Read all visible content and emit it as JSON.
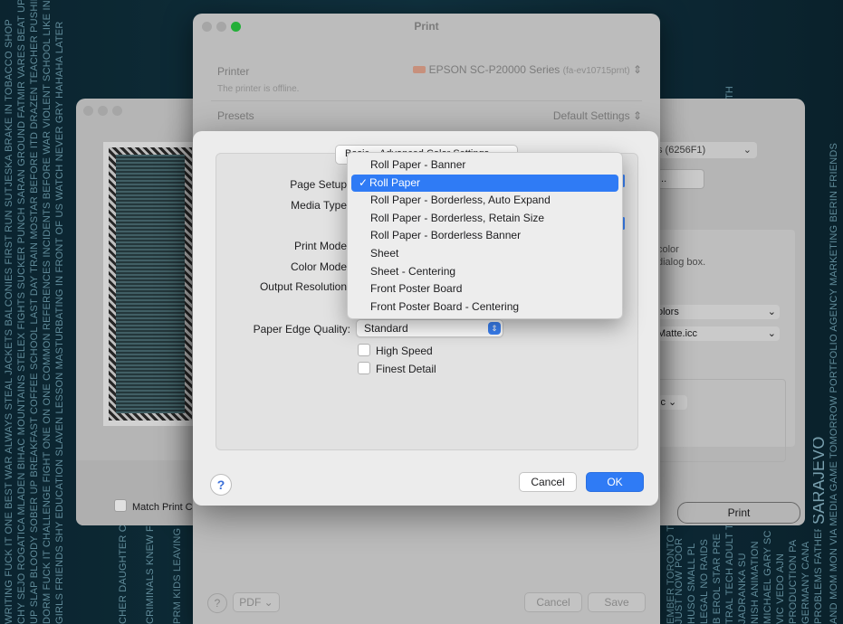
{
  "wallpaper": {
    "columns": [
      "WRITING FUCK IT ONE BEST WAR ALWAYS STEAL JACKETS BALCONIES FIRST RUN SUTJESKA BRAKE IN TOBACCO SHOP",
      "CHY SEJO ROGATICA MLADEN BIHAC MOUNTAINS STELEX FIGHTS SUCKER PUNCH SARAN GROUND FATMIR VARES BEAT UP",
      "UP SLAP BLOODY SOBER UP BREAKFAST COFFEE SCHOOL LAST DAY TRAIN MOSTAR BEFORE ITD DRAZEN TEACHER PUSHING",
      "DORM FUCK IT CHALLENGE FIGHT ONE ON ONE COMMON REFERENCES INCIDENTS BEFORE WAR VIOLENT SCHOOL LIKE INT",
      "GIRLS FRIENDS SHY EDUCATION SLAVEN LESSON MASTURBATING IN FRONT OF US WATCH NEVER GRY HAHAHA LATER",
      "CHER DAUGHTER CRIMINALS TRAP HALA I KNEW PAST BEST FRIEND PARING WAR ADVENTURE",
      "CRIMINALS KNEW FRIENDS GA BEST PARING WAR KIDS LEAVING DOES COUSIN KILL",
      "PRM KIDS LEAVING COUSIN KILL NIS APARTMENT",
      "EMBER TORONTO TORONTO RONCESVALLES LEAVES SUPER SARAJEVANS GO",
      "TRAL TECH ADULT TRANSPORT CIGARETTES BOSNIANS ENTHUSIASM SEPTEMBER PREGNANT SON DEATH",
      "AND MOM MON VIA MEDIA GAME TOMORROW PORTFOLIO AGENCY MARKETING BERIN FRIENDS"
    ],
    "big_word": "SARAJEVO",
    "bottom_words": [
      "JUST NOW POOR",
      "HUSO SMALL PL",
      "LEGAL NO RAIDS",
      "B EROL STAR PRE",
      "JADRANKA SU",
      "NISH ANIMATION",
      "MICHAEL GARY SC",
      "VIC VEDO AJN",
      "PRODUCTION PA",
      "GERMANY CANA",
      "PROBLEMS FATHER IN LAW"
    ]
  },
  "print_window": {
    "title": "Print",
    "printer_label": "Printer",
    "printer_value": "EPSON SC-P20000 Series",
    "printer_id": "(fa-ev10715prnt)",
    "printer_status": "The printer is offline.",
    "presets_label": "Presets",
    "presets_value": "Default Settings",
    "pdf_label": "PDF",
    "cancel_label": "Cancel",
    "save_label": "Save",
    "help_label": "?"
  },
  "left_window": {
    "match_print_label": "Match Print C"
  },
  "right_window": {
    "printer_short": "s (6256F1)",
    "button_dots": "...",
    "color_text_1": "color",
    "color_text_2": "dialog box.",
    "colors_value": "olors",
    "profile_value": "Matte.icc",
    "dropdown_partial": "ic",
    "print_button": "Print"
  },
  "sheet": {
    "tabs": [
      "Basic",
      "Advanced Color Settings"
    ],
    "labels": {
      "page_setup": "Page Setup",
      "media_type": "Media Type",
      "print_mode": "Print Mode",
      "color_mode": "Color Mode",
      "output_resolution": "Output Resolution",
      "paper_edge_quality": "Paper Edge Quality:"
    },
    "paper_edge_value": "Standard",
    "checkboxes": [
      "High Speed",
      "Finest Detail"
    ],
    "help_label": "?",
    "cancel_label": "Cancel",
    "ok_label": "OK"
  },
  "menu": {
    "selected_index": 1,
    "items": [
      "Roll Paper - Banner",
      "Roll Paper",
      "Roll Paper - Borderless, Auto Expand",
      "Roll Paper - Borderless, Retain Size",
      "Roll Paper - Borderless Banner",
      "Sheet",
      "Sheet - Centering",
      "Front Poster Board",
      "Front Poster Board - Centering"
    ]
  },
  "colors": {
    "accent": "#2f7bf5",
    "traffic_green": "#28c840"
  }
}
